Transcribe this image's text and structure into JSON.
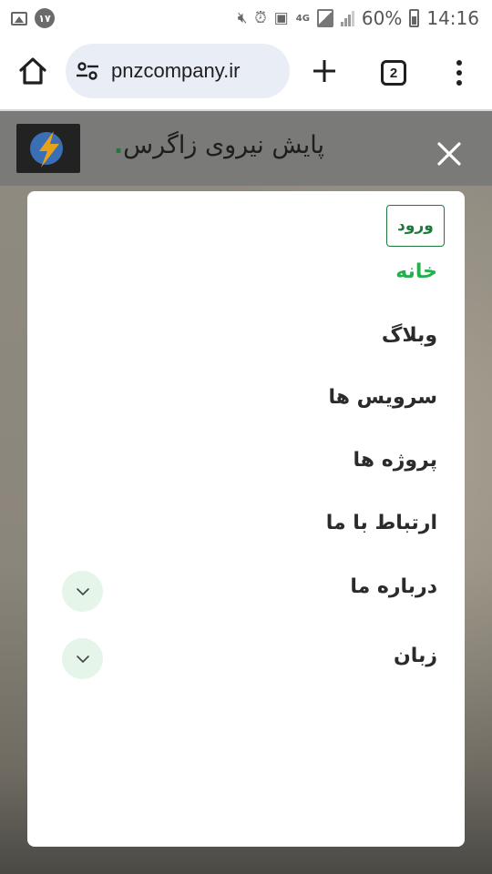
{
  "status_bar": {
    "badge_number": "۱۷",
    "network": "4G",
    "battery_percent": "60%",
    "time": "14:16"
  },
  "browser": {
    "url": "pnzcompany.ir",
    "tab_count": "2"
  },
  "site": {
    "title": "پایش نیروی زاگرس",
    "title_dot": "."
  },
  "menu": {
    "login_label": "ورود",
    "items": [
      {
        "label": "خانه",
        "active": true
      },
      {
        "label": "وبلاگ"
      },
      {
        "label": "سرویس ها"
      },
      {
        "label": "پروژه ها"
      },
      {
        "label": "ارتباط با ما"
      },
      {
        "label": "درباره ما",
        "expandable": true
      },
      {
        "label": "زبان",
        "expandable": true
      }
    ]
  },
  "colors": {
    "accent_green": "#1d7a3a",
    "active_green": "#22b14c",
    "url_bar_bg": "#e9eef6",
    "expand_bg": "#e6f5ea"
  }
}
